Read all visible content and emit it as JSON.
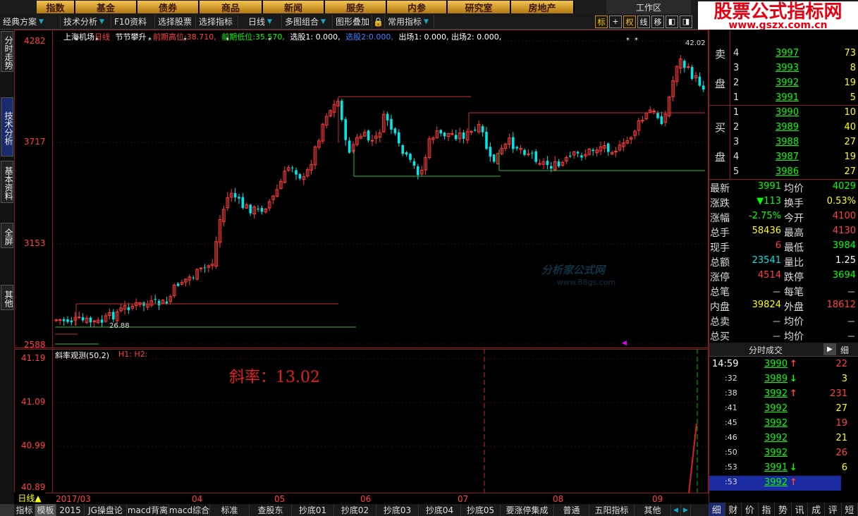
{
  "topnav": {
    "items": [
      "指数",
      "基金",
      "债券",
      "商品",
      "新闻",
      "服务",
      "内参",
      "研究室",
      "房地产"
    ],
    "workzone": "工作区"
  },
  "toolbar": {
    "items": [
      "经典方案",
      "技术分析",
      "F10资料",
      "选择股票",
      "选择指标",
      "日线",
      "多图组合",
      "图形叠加",
      "常用指标"
    ],
    "icons": [
      "标",
      "+",
      "权",
      "线",
      "移",
      "left-panel",
      "right-panel"
    ]
  },
  "banner": {
    "title": "股票公式指标网",
    "url": "www.gszx.com.cn"
  },
  "left_tabs": [
    "分时走势",
    "技术分析",
    "基本资料",
    "全屏",
    "其他"
  ],
  "main": {
    "header_stock": "上海机场",
    "header_period": "日线",
    "header_indicator": "节节攀升",
    "header_high_label": "前期高位:",
    "header_high": "38.710,",
    "header_low_label": "前期低位:",
    "header_low": "35.570,",
    "header_rest": "选股1: 0.000,",
    "header_sel2": "选股2:",
    "header_sel2_val": "0.000,",
    "header_tail": "出场1: 0.000, 出场2: 0.000,",
    "y_labels": [
      "4282",
      "3717",
      "3153",
      "2588"
    ],
    "max_label": "42.02",
    "min_label": "26.88",
    "watermark": "分析家公式网",
    "watermark_url": "www.88gs.com"
  },
  "sub": {
    "title": "斜率观测(50,2)",
    "h_labels": "H1: H2:",
    "slope_text": "斜率：13.02",
    "y_labels": [
      "41.19",
      "41.09",
      "40.99",
      "40.89"
    ]
  },
  "date_bar": {
    "start": "2017/03",
    "months": [
      "04",
      "05",
      "06",
      "07",
      "08",
      "09"
    ]
  },
  "bottom_tabs": [
    "日线▲",
    "指标",
    "模板",
    "2015",
    "JG操盘论",
    "macd背离",
    "macd综合",
    "标准",
    "查股东",
    "抄底01",
    "抄底02",
    "抄底03",
    "抄底04",
    "抄底05",
    "要涨停集成",
    "普通",
    "五阳指标",
    "其他"
  ],
  "orderbook": {
    "sell_label": [
      "卖",
      "盘"
    ],
    "buy_label": [
      "买",
      "盘"
    ],
    "sell": [
      {
        "lvl": "4",
        "price": "3997",
        "vol": "73"
      },
      {
        "lvl": "3",
        "price": "3993",
        "vol": "8"
      },
      {
        "lvl": "2",
        "price": "3992",
        "vol": "19"
      },
      {
        "lvl": "1",
        "price": "3991",
        "vol": "5"
      }
    ],
    "buy": [
      {
        "lvl": "1",
        "price": "3990",
        "vol": "10"
      },
      {
        "lvl": "2",
        "price": "3989",
        "vol": "40"
      },
      {
        "lvl": "3",
        "price": "3988",
        "vol": "27"
      },
      {
        "lvl": "4",
        "price": "3987",
        "vol": "19"
      },
      {
        "lvl": "5",
        "price": "3986",
        "vol": "27"
      }
    ]
  },
  "stats": [
    {
      "l1": "最新",
      "v1": "3991",
      "l2": "均价",
      "v2": "4029"
    },
    {
      "l1": "涨跌",
      "v1": "▼113",
      "l2": "换手",
      "v2": "0.53%"
    },
    {
      "l1": "涨幅",
      "v1": "-2.75%",
      "l2": "今开",
      "v2": "4100"
    },
    {
      "l1": "总手",
      "v1": "58436",
      "l2": "最高",
      "v2": "4130"
    },
    {
      "l1": "现手",
      "v1": "6",
      "l2": "最低",
      "v2": "3984"
    },
    {
      "l1": "总额",
      "v1": "23541",
      "l2": "量比",
      "v2": "1.25"
    },
    {
      "l1": "涨停",
      "v1": "4514",
      "l2": "跌停",
      "v2": "3694"
    },
    {
      "l1": "总笔",
      "v1": "－",
      "l2": "每笔",
      "v2": "－"
    },
    {
      "l1": "内盘",
      "v1": "39824",
      "l2": "外盘",
      "v2": "18612"
    },
    {
      "l1": "总卖",
      "v1": "－",
      "l2": "均价",
      "v2": "－"
    },
    {
      "l1": "总买",
      "v1": "－",
      "l2": "均价",
      "v2": "－"
    }
  ],
  "ticks_header": "分时成交",
  "ticks_detail": "细",
  "ticks": [
    {
      "t": "14:59",
      "p": "3990",
      "d": "↑",
      "v": "22"
    },
    {
      "t": ":32",
      "p": "3989",
      "d": "↓",
      "v": "3"
    },
    {
      "t": ":38",
      "p": "3992",
      "d": "↑",
      "v": "231"
    },
    {
      "t": ":41",
      "p": "3992",
      "d": "",
      "v": "27"
    },
    {
      "t": ":45",
      "p": "3992",
      "d": "",
      "v": "19"
    },
    {
      "t": ":46",
      "p": "3992",
      "d": "",
      "v": "21"
    },
    {
      "t": ":50",
      "p": "3992",
      "d": "",
      "v": "26"
    },
    {
      "t": ":53",
      "p": "3991",
      "d": "↓",
      "v": "6"
    },
    {
      "t": ":53",
      "p": "3992",
      "d": "↑",
      "v": ""
    }
  ],
  "right_tabs": [
    "细",
    "财",
    "价",
    "指",
    "势",
    "讯",
    "成",
    "评",
    "短"
  ],
  "colors": {
    "up": "#ff3b3b",
    "down": "#00e5e5",
    "frame": "#8b1a1a",
    "yellow": "#ffff00",
    "green": "#00ff00"
  }
}
